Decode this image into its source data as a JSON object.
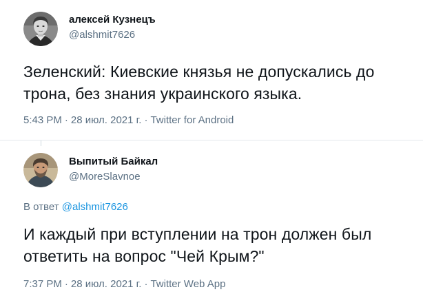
{
  "tweets": [
    {
      "display_name": "алексей Кузнецъ",
      "handle": "@alshmit7626",
      "text": "Зеленский: Киевские князья не допускались до\nтрона, без знания украинского языка.",
      "time": "5:43 PM",
      "separator": "·",
      "date": "28 июл. 2021 г.",
      "source": "Twitter for Android",
      "avatar_icon": "avatar-boy-portrait"
    },
    {
      "display_name": "Выпитый Байкал",
      "handle": "@MoreSlavnoe",
      "reply_prefix": "В ответ",
      "reply_mention": "@alshmit7626",
      "text": "И каждый при вступлении на трон должен был\nответить на вопрос \"Чей Крым?\"",
      "time": "7:37 PM",
      "separator": "·",
      "date": "28 июл. 2021 г.",
      "source": "Twitter Web App",
      "avatar_icon": "avatar-man-portrait"
    }
  ],
  "colors": {
    "text": "#0f1419",
    "secondary": "#5b7083",
    "link": "#1b95e0",
    "divider": "#e3e8ec"
  }
}
